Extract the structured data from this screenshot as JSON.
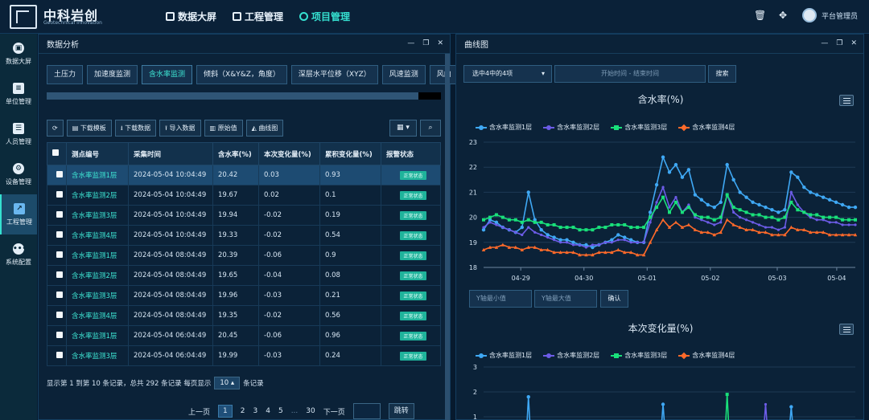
{
  "brand": {
    "name_cn": "中科岩创",
    "name_en": "Geotechnical Innovation"
  },
  "topnav": [
    {
      "label": "数据大屏",
      "icon": "cube-icon"
    },
    {
      "label": "工程管理",
      "icon": "chart-icon"
    },
    {
      "label": "项目管理",
      "icon": "ring-icon",
      "active": true
    }
  ],
  "user": {
    "name": "平台管理员"
  },
  "sidebar": [
    {
      "label": "数据大屏",
      "icon": "cube-icon"
    },
    {
      "label": "单位管理",
      "icon": "clipboard-icon"
    },
    {
      "label": "人员管理",
      "icon": "id-card-icon"
    },
    {
      "label": "设备管理",
      "icon": "gear-icon"
    },
    {
      "label": "工程管理",
      "icon": "line-chart-icon",
      "active": true
    },
    {
      "label": "系统配置",
      "icon": "more-icon"
    }
  ],
  "left_panel": {
    "title": "数据分析",
    "tabs": [
      "土压力",
      "加速度监测",
      "含水率监测",
      "倾斜（X&Y&Z，角度）",
      "深层水平位移（XYZ）",
      "风速监测",
      "风向"
    ],
    "active_tab": 2,
    "toolbar": [
      "下载模板",
      "下载数据",
      "导入数据",
      "原始值",
      "曲线图"
    ],
    "columns": [
      "测点编号",
      "采集时间",
      "含水率(%)",
      "本次变化量(%)",
      "累积变化量(%)",
      "报警状态"
    ],
    "rows": [
      {
        "id": "含水率监测1层",
        "time": "2024-05-04 10:04:49",
        "value": "20.42",
        "change": "0.03",
        "total": "0.93",
        "status": "正常状态"
      },
      {
        "id": "含水率监测2层",
        "time": "2024-05-04 10:04:49",
        "value": "19.67",
        "change": "0.02",
        "total": "0.1",
        "status": "正常状态"
      },
      {
        "id": "含水率监测3层",
        "time": "2024-05-04 10:04:49",
        "value": "19.94",
        "change": "-0.02",
        "total": "0.19",
        "status": "正常状态"
      },
      {
        "id": "含水率监测4层",
        "time": "2024-05-04 10:04:49",
        "value": "19.33",
        "change": "-0.02",
        "total": "0.54",
        "status": "正常状态"
      },
      {
        "id": "含水率监测1层",
        "time": "2024-05-04 08:04:49",
        "value": "20.39",
        "change": "-0.06",
        "total": "0.9",
        "status": "正常状态"
      },
      {
        "id": "含水率监测2层",
        "time": "2024-05-04 08:04:49",
        "value": "19.65",
        "change": "-0.04",
        "total": "0.08",
        "status": "正常状态"
      },
      {
        "id": "含水率监测3层",
        "time": "2024-05-04 08:04:49",
        "value": "19.96",
        "change": "-0.03",
        "total": "0.21",
        "status": "正常状态"
      },
      {
        "id": "含水率监测4层",
        "time": "2024-05-04 08:04:49",
        "value": "19.35",
        "change": "-0.02",
        "total": "0.56",
        "status": "正常状态"
      },
      {
        "id": "含水率监测1层",
        "time": "2024-05-04 06:04:49",
        "value": "20.45",
        "change": "-0.06",
        "total": "0.96",
        "status": "正常状态"
      },
      {
        "id": "含水率监测3层",
        "time": "2024-05-04 06:04:49",
        "value": "19.99",
        "change": "-0.03",
        "total": "0.24",
        "status": "正常状态"
      }
    ],
    "page_info": {
      "prefix": "显示第 1 到第 10 条记录，总共 292 条记录 每页显示",
      "size": "10",
      "suffix": "条记录"
    },
    "pager": {
      "prev": "上一页",
      "pages": [
        "1",
        "2",
        "3",
        "4",
        "5",
        "...",
        "30"
      ],
      "next": "下一页",
      "go": "跳转"
    }
  },
  "right_panel": {
    "title": "曲线图",
    "select": "选中4中的4项",
    "date_placeholder": "开始时间 - 结束时间",
    "search": "搜索",
    "ymin_placeholder": "Y轴最小值",
    "ymax_placeholder": "Y轴最大值",
    "confirm": "确认"
  },
  "colors": {
    "s1": "#3fa8f4",
    "s2": "#6c5ce7",
    "s3": "#19e07a",
    "s4": "#ff6a2a",
    "accent": "#3ee6d4"
  },
  "chart_data": [
    {
      "type": "line",
      "title": "含水率(%)",
      "ylim": [
        18,
        23
      ],
      "yticks": [
        18,
        19,
        20,
        21,
        22,
        23
      ],
      "xticks": [
        "04-29",
        "04-30",
        "05-01",
        "05-02",
        "05-03",
        "05-04"
      ],
      "legend_position": "top-left",
      "grid": "horizontal",
      "series": [
        {
          "name": "含水率监测1层",
          "values": [
            19.5,
            19.9,
            19.8,
            19.6,
            19.5,
            19.4,
            19.6,
            21.0,
            19.9,
            19.5,
            19.3,
            19.2,
            19.1,
            19.1,
            19.0,
            18.9,
            18.9,
            18.8,
            18.9,
            19.0,
            19.1,
            19.3,
            19.2,
            19.1,
            19.0,
            19.0,
            20.2,
            21.3,
            22.4,
            21.8,
            22.1,
            21.6,
            21.9,
            20.9,
            20.7,
            20.5,
            20.4,
            20.6,
            22.1,
            21.5,
            21.0,
            20.8,
            20.6,
            20.5,
            20.4,
            20.3,
            20.2,
            20.3,
            21.8,
            21.6,
            21.2,
            21.0,
            20.9,
            20.8,
            20.7,
            20.6,
            20.5,
            20.4,
            20.4
          ]
        },
        {
          "name": "含水率监测2层",
          "values": [
            19.6,
            19.8,
            19.7,
            19.6,
            19.5,
            19.4,
            19.3,
            19.6,
            19.4,
            19.3,
            19.2,
            19.1,
            19.0,
            19.0,
            18.9,
            18.9,
            18.8,
            18.9,
            18.9,
            19.0,
            19.0,
            19.1,
            19.1,
            19.0,
            19.0,
            19.0,
            19.8,
            20.6,
            21.2,
            20.4,
            20.8,
            20.2,
            20.5,
            20.0,
            19.9,
            19.8,
            19.7,
            19.8,
            20.9,
            20.2,
            20.0,
            19.9,
            19.8,
            19.7,
            19.6,
            19.6,
            19.5,
            19.6,
            21.0,
            20.5,
            20.2,
            20.0,
            19.9,
            19.9,
            19.8,
            19.8,
            19.7,
            19.7,
            19.7
          ]
        },
        {
          "name": "含水率监测3层",
          "values": [
            19.9,
            20.0,
            20.1,
            20.0,
            19.9,
            19.9,
            19.8,
            19.9,
            19.8,
            19.8,
            19.7,
            19.7,
            19.6,
            19.6,
            19.6,
            19.5,
            19.5,
            19.5,
            19.6,
            19.6,
            19.7,
            19.7,
            19.7,
            19.6,
            19.6,
            19.6,
            20.0,
            20.4,
            20.8,
            20.2,
            20.6,
            20.2,
            20.4,
            20.1,
            20.0,
            20.0,
            19.9,
            20.0,
            20.9,
            20.4,
            20.3,
            20.2,
            20.1,
            20.1,
            20.0,
            20.0,
            19.9,
            20.0,
            20.6,
            20.3,
            20.2,
            20.1,
            20.1,
            20.0,
            20.0,
            20.0,
            19.9,
            19.9,
            19.9
          ]
        },
        {
          "name": "含水率监测4层",
          "values": [
            18.7,
            18.8,
            18.8,
            18.9,
            18.8,
            18.8,
            18.7,
            18.8,
            18.8,
            18.7,
            18.7,
            18.6,
            18.6,
            18.6,
            18.6,
            18.5,
            18.5,
            18.5,
            18.6,
            18.6,
            18.6,
            18.7,
            18.6,
            18.6,
            18.5,
            18.5,
            19.0,
            19.5,
            19.9,
            19.6,
            19.8,
            19.6,
            19.7,
            19.5,
            19.4,
            19.4,
            19.3,
            19.4,
            19.9,
            19.7,
            19.6,
            19.5,
            19.5,
            19.4,
            19.4,
            19.3,
            19.3,
            19.3,
            19.6,
            19.5,
            19.5,
            19.4,
            19.4,
            19.4,
            19.3,
            19.3,
            19.3,
            19.3,
            19.3
          ]
        }
      ]
    },
    {
      "type": "line",
      "title": "本次变化量(%)",
      "ylim": [
        1,
        3
      ],
      "yticks": [
        1,
        2,
        3
      ],
      "legend_position": "top-left",
      "grid": "horizontal",
      "series": [
        {
          "name": "含水率监测1层"
        },
        {
          "name": "含水率监测2层"
        },
        {
          "name": "含水率监测3层"
        },
        {
          "name": "含水率监测4层"
        }
      ],
      "visible_spikes": [
        {
          "series": 0,
          "x_index": 7,
          "y": 1.8
        },
        {
          "series": 0,
          "x_index": 28,
          "y": 1.5
        },
        {
          "series": 2,
          "x_index": 38,
          "y": 1.9
        },
        {
          "series": 1,
          "x_index": 44,
          "y": 1.5
        },
        {
          "series": 0,
          "x_index": 48,
          "y": 1.4
        }
      ]
    }
  ]
}
